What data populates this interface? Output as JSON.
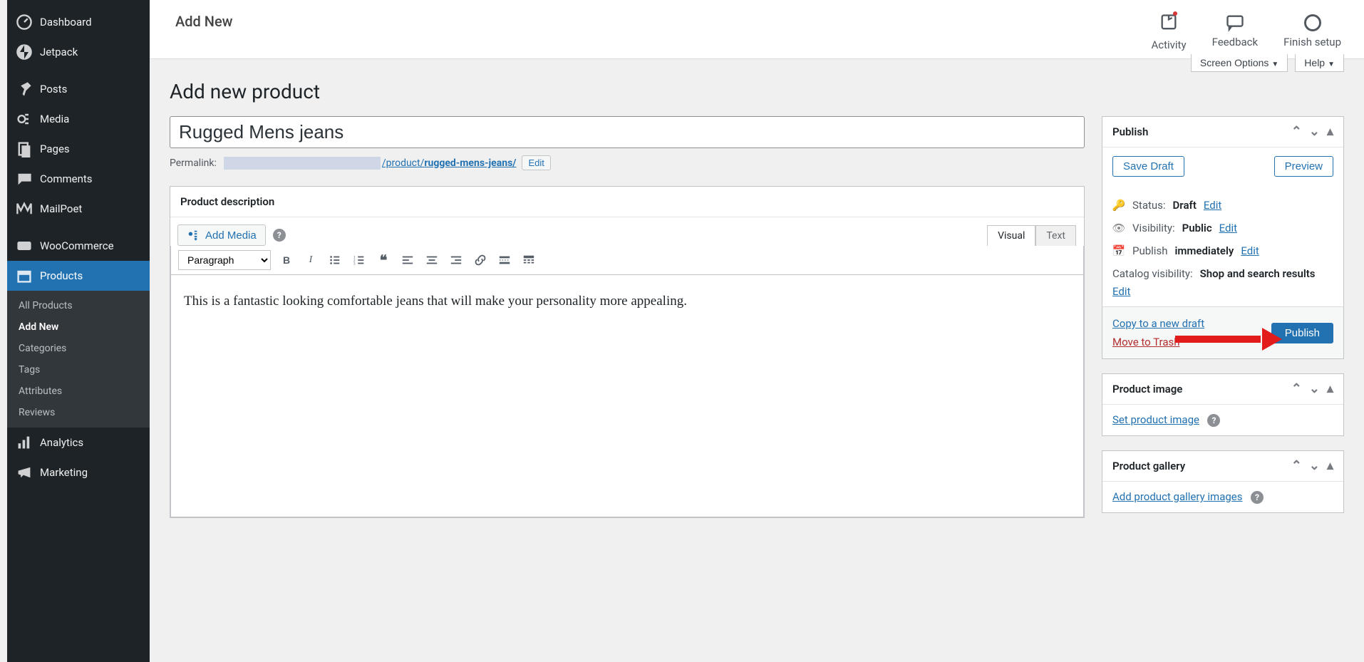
{
  "sidebar": {
    "items": [
      {
        "label": "Dashboard"
      },
      {
        "label": "Jetpack"
      },
      {
        "label": "Posts"
      },
      {
        "label": "Media"
      },
      {
        "label": "Pages"
      },
      {
        "label": "Comments"
      },
      {
        "label": "MailPoet"
      },
      {
        "label": "WooCommerce"
      },
      {
        "label": "Products"
      },
      {
        "label": "Analytics"
      },
      {
        "label": "Marketing"
      }
    ],
    "products_sub": [
      "All Products",
      "Add New",
      "Categories",
      "Tags",
      "Attributes",
      "Reviews"
    ]
  },
  "topbar": {
    "title": "Add New",
    "actions": [
      "Activity",
      "Feedback",
      "Finish setup"
    ]
  },
  "screen_options": "Screen Options",
  "help": "Help",
  "page_heading": "Add new product",
  "title_value": "Rugged Mens jeans",
  "permalink": {
    "label": "Permalink:",
    "path": "/product/",
    "slug": "rugged-mens-jeans/",
    "edit": "Edit"
  },
  "editor": {
    "panel_title": "Product description",
    "add_media": "Add Media",
    "tabs": [
      "Visual",
      "Text"
    ],
    "format_select": "Paragraph",
    "content": "This is a fantastic looking comfortable jeans that will make your personality more appealing."
  },
  "publish": {
    "title": "Publish",
    "save_draft": "Save Draft",
    "preview": "Preview",
    "status_label": "Status:",
    "status_value": "Draft",
    "edit": "Edit",
    "visibility_label": "Visibility:",
    "visibility_value": "Public",
    "publish_label": "Publish",
    "publish_value": "immediately",
    "catalog_label": "Catalog visibility:",
    "catalog_value": "Shop and search results",
    "copy": "Copy to a new draft",
    "trash": "Move to Trash",
    "publish_btn": "Publish"
  },
  "product_image": {
    "title": "Product image",
    "set": "Set product image"
  },
  "product_gallery": {
    "title": "Product gallery",
    "add": "Add product gallery images"
  }
}
